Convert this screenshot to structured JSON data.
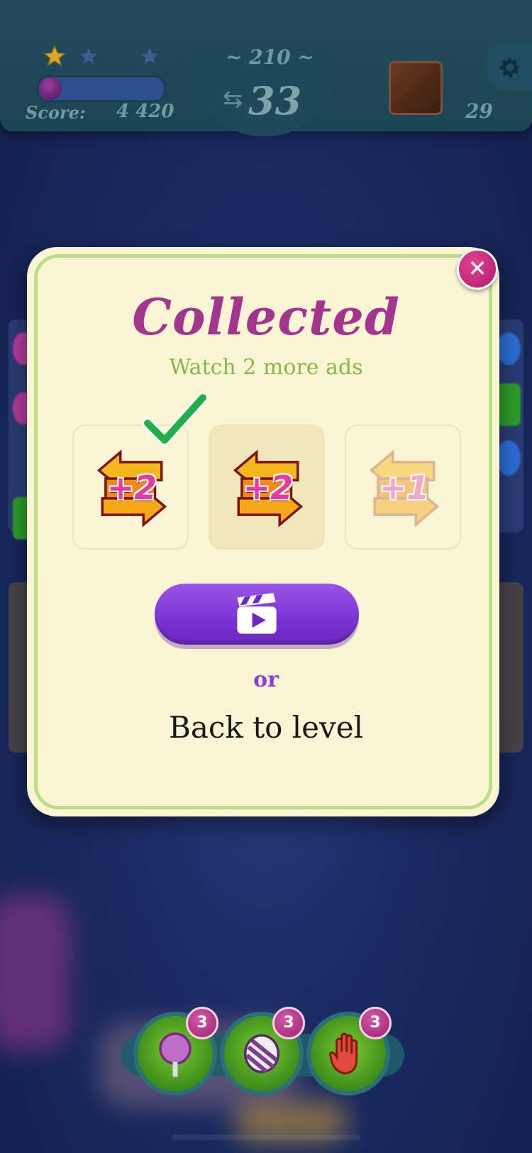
{
  "hud": {
    "level": "~ 210 ~",
    "moves": "33",
    "score_label": "Score:",
    "score_value": "4 420",
    "goal_count": "29",
    "stars_earned": 1,
    "stars_total": 3,
    "score_progress": 0.18
  },
  "dialog": {
    "title": "Collected",
    "subtitle": "Watch 2 more ads",
    "close_icon": "close-icon",
    "rewards": [
      {
        "label": "+2",
        "state": "collected",
        "icon": "moves-arrows-icon"
      },
      {
        "label": "+2",
        "state": "current",
        "icon": "moves-arrows-icon"
      },
      {
        "label": "+1",
        "state": "locked",
        "icon": "moves-arrows-icon"
      }
    ],
    "watch_button_icon": "clapperboard-play-icon",
    "or_text": "or",
    "back_label": "Back to level"
  },
  "boosters": [
    {
      "name": "lollipop-hammer",
      "count": "3"
    },
    {
      "name": "striped-wrapped",
      "count": "3"
    },
    {
      "name": "switch-hand",
      "count": "3"
    }
  ],
  "colors": {
    "title": "#a3358f",
    "subtitle": "#86b54b",
    "button": "#7a33d2",
    "dialog_bg": "#fbf5d4",
    "dialog_border": "#b9df8b"
  }
}
